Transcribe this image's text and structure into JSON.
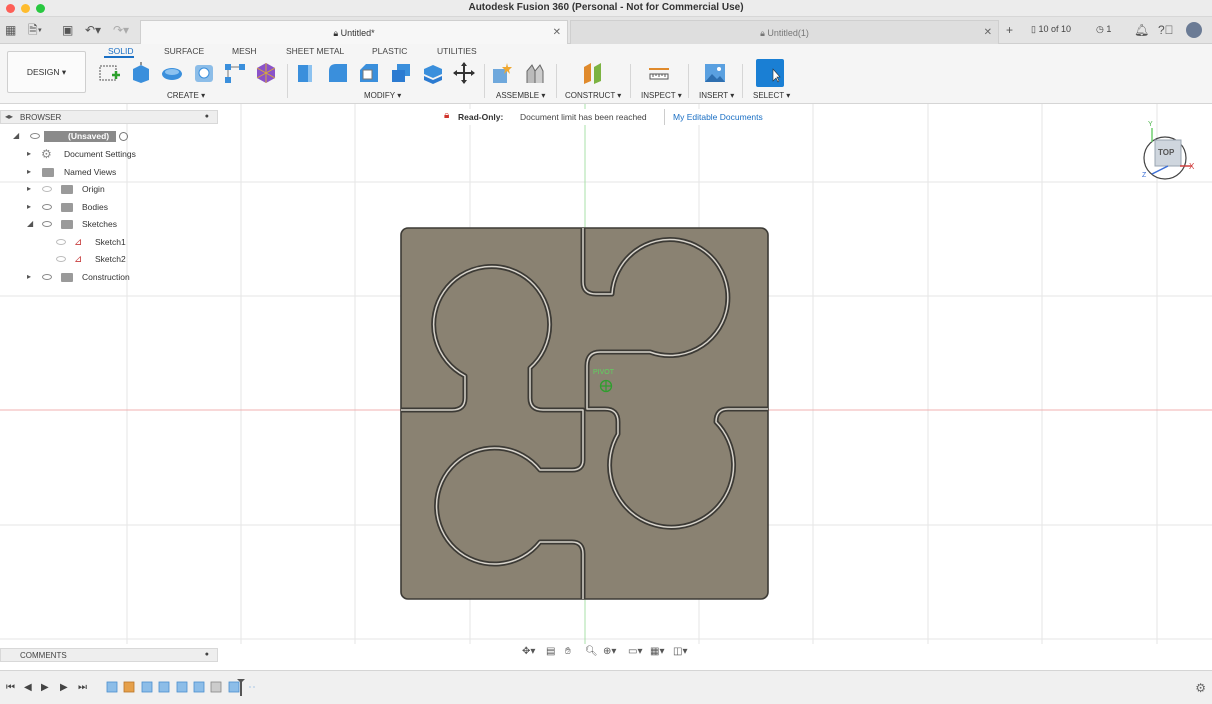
{
  "window": {
    "title": "Autodesk Fusion 360 (Personal - Not for Commercial Use)"
  },
  "tabs": [
    {
      "label": "Untitled*",
      "active": true
    },
    {
      "label": "Untitled(1)",
      "active": false
    }
  ],
  "tabbar": {
    "doc_count": "10 of 10",
    "jobs_count": "1"
  },
  "toolbar": {
    "workspace": "DESIGN",
    "workspace_tabs": [
      "SOLID",
      "SURFACE",
      "MESH",
      "SHEET METAL",
      "PLASTIC",
      "UTILITIES"
    ],
    "groups": {
      "create": "CREATE",
      "modify": "MODIFY",
      "assemble": "ASSEMBLE",
      "construct": "CONSTRUCT",
      "inspect": "INSPECT",
      "insert": "INSERT",
      "select": "SELECT"
    },
    "accent": "#1a6fc4"
  },
  "browser": {
    "header": "BROWSER",
    "root": "(Unsaved)",
    "items": [
      {
        "label": "Document Settings",
        "icon": "gear-icon"
      },
      {
        "label": "Named Views",
        "icon": "folder-icon"
      },
      {
        "label": "Origin",
        "icon": "folder-icon"
      },
      {
        "label": "Bodies",
        "icon": "folder-icon"
      },
      {
        "label": "Sketches",
        "icon": "folder-icon"
      },
      {
        "label": "Sketch1",
        "icon": "sketch-icon"
      },
      {
        "label": "Sketch2",
        "icon": "sketch-icon"
      },
      {
        "label": "Construction",
        "icon": "folder-icon"
      }
    ]
  },
  "banner": {
    "title": "Read-Only:",
    "message": "Document limit has been reached",
    "link": "My Editable Documents"
  },
  "viewcube": {
    "face": "TOP",
    "axis_x": "X",
    "axis_y": "Y",
    "axis_z": "Z"
  },
  "canvas": {
    "pivot_label": "PIVOT",
    "part_color": "#8a8272"
  },
  "comments": {
    "header": "COMMENTS"
  }
}
